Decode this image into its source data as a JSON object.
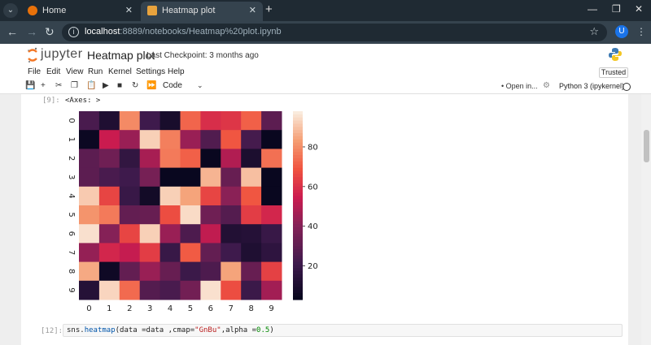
{
  "browser": {
    "tabs": [
      {
        "label": "Home",
        "active": false
      },
      {
        "label": "Heatmap plot",
        "active": true
      }
    ],
    "url_host": "localhost",
    "url_rest": ":8889/notebooks/Heatmap%20plot.ipynb",
    "avatar_letter": "U"
  },
  "jupyter": {
    "brand": "jupyter",
    "notebook_title": "Heatmap plot",
    "checkpoint": "Last Checkpoint: 3 months ago",
    "menu": [
      "File",
      "Edit",
      "View",
      "Run",
      "Kernel",
      "Settings",
      "Help"
    ],
    "trusted": "Trusted",
    "cell_type": "Code",
    "open_in": "Open in...",
    "kernel": "Python 3 (ipykernel)"
  },
  "cells": {
    "out_prompt": "[9]:",
    "out_text": "<Axes: >",
    "in_prompt": "[12]:",
    "code_parts": {
      "pre": "sns.",
      "fn": "heatmap",
      "mid1": "(data =data ,cmap=",
      "str": "\"GnBu\"",
      "mid2": ",alpha =",
      "num": "0.5",
      "post": ")"
    }
  },
  "chart_data": {
    "type": "heatmap",
    "x_ticks": [
      "0",
      "1",
      "2",
      "3",
      "4",
      "5",
      "6",
      "7",
      "8",
      "9"
    ],
    "y_ticks": [
      "0",
      "1",
      "2",
      "3",
      "4",
      "5",
      "6",
      "7",
      "8",
      "9"
    ],
    "colorbar_ticks": [
      20,
      40,
      60,
      80
    ],
    "colorbar_range": [
      3,
      98
    ],
    "colormap": "rocket",
    "values": [
      [
        25,
        12,
        80,
        22,
        10,
        73,
        60,
        62,
        72,
        30
      ],
      [
        6,
        55,
        45,
        93,
        78,
        45,
        27,
        70,
        24,
        5
      ],
      [
        30,
        35,
        18,
        48,
        77,
        72,
        5,
        50,
        11,
        75
      ],
      [
        30,
        25,
        22,
        37,
        5,
        5,
        88,
        33,
        90,
        5
      ],
      [
        92,
        66,
        20,
        8,
        93,
        85,
        66,
        42,
        70,
        5
      ],
      [
        82,
        77,
        32,
        33,
        68,
        95,
        35,
        28,
        64,
        58
      ],
      [
        96,
        41,
        66,
        93,
        45,
        26,
        53,
        13,
        14,
        20
      ],
      [
        44,
        58,
        54,
        64,
        20,
        71,
        32,
        22,
        12,
        17
      ],
      [
        86,
        7,
        32,
        45,
        33,
        21,
        26,
        85,
        33,
        65
      ],
      [
        14,
        94,
        74,
        28,
        25,
        36,
        96,
        68,
        21,
        47
      ]
    ]
  }
}
